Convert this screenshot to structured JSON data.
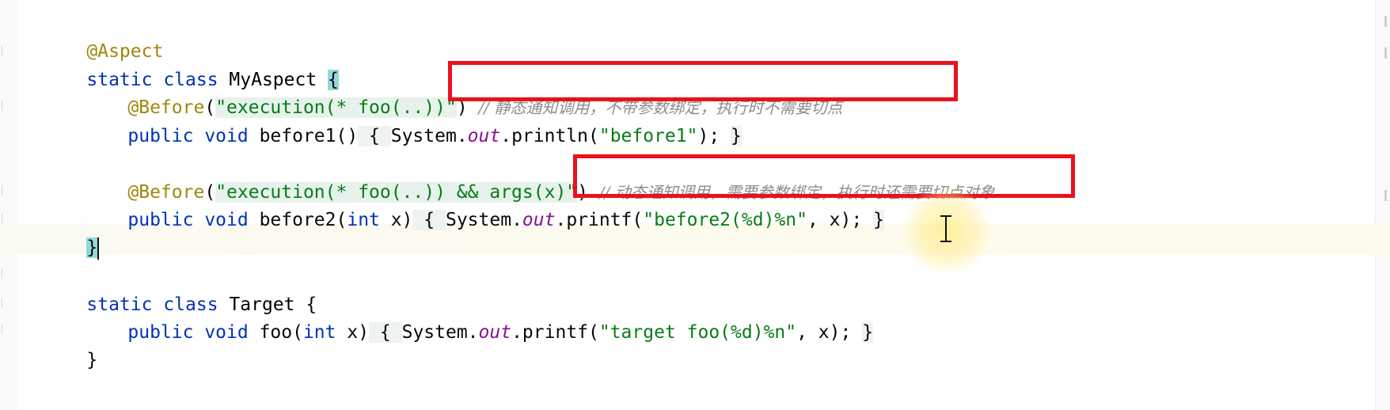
{
  "code": {
    "l1": {
      "annotation": "@Aspect"
    },
    "l2": {
      "kw": "static class ",
      "name": "MyAspect ",
      "brace": "{"
    },
    "l3": {
      "annotation": "@Before",
      "open": "(",
      "str": "\"execution(* foo(..))\"",
      "close": ")",
      "comment": "// 静态通知调用，不带参数绑定，执行时不需要切点"
    },
    "l4": {
      "kw": "public void ",
      "name": "before1()",
      "body_open": " { ",
      "sys": "System.",
      "field": "out",
      "call": ".println(",
      "str": "\"before1\"",
      "end": "); ",
      "body_close": "}"
    },
    "l6": {
      "annotation": "@Before",
      "open": "(",
      "str": "\"execution(* foo(..)) && args(x)\"",
      "close": ")",
      "comment": "// 动态通知调用，需要参数绑定，执行时还需要切点对象"
    },
    "l7": {
      "kw": "public void ",
      "name": "before2(",
      "param_kw": "int",
      "param": " x)",
      "body_open": " { ",
      "sys": "System.",
      "field": "out",
      "call": ".printf(",
      "str": "\"before2(%d)%n\"",
      "end": ", x); ",
      "body_close": "}"
    },
    "l8": {
      "brace": "}"
    },
    "l10": {
      "kw": "static class ",
      "name": "Target ",
      "brace": "{"
    },
    "l11": {
      "kw": "public void ",
      "name": "foo(",
      "param_kw": "int",
      "param": " x)",
      "body_open": " { ",
      "sys": "System.",
      "field": "out",
      "call": ".printf(",
      "str": "\"target foo(%d)%n\"",
      "end": ", x); ",
      "body_close": "}"
    },
    "l12": {
      "brace": "}"
    }
  },
  "colors": {
    "annotation": "#9e880d",
    "keyword": "#0033b3",
    "string": "#067d17",
    "field": "#871094",
    "comment": "#8c8c8c",
    "highlight_box": "#e8121e"
  }
}
